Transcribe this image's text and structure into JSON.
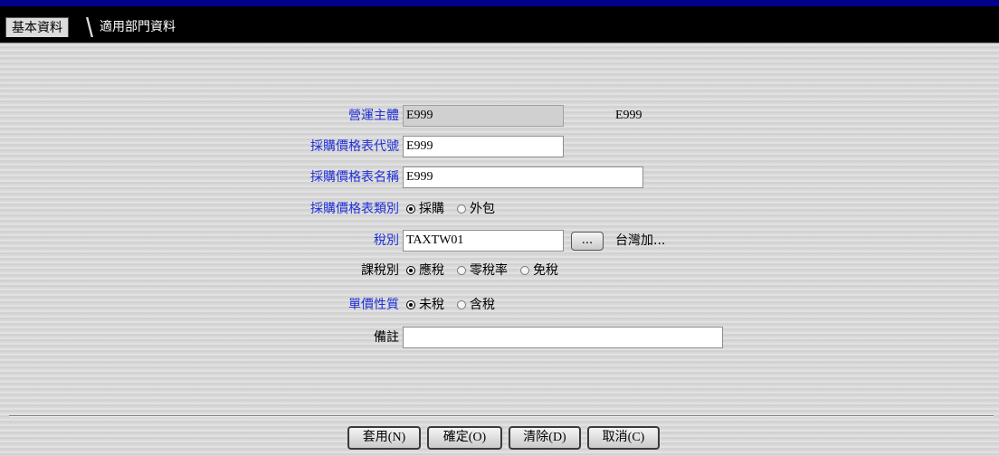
{
  "tabs": [
    {
      "label": "基本資料",
      "active": true
    },
    {
      "label": "適用部門資料",
      "active": false
    }
  ],
  "form": {
    "entity": {
      "label": "營運主體",
      "value": "E999",
      "display": "E999"
    },
    "code": {
      "label": "採購價格表代號",
      "value": "E999"
    },
    "name": {
      "label": "採購價格表名稱",
      "value": "E999"
    },
    "category": {
      "label": "採購價格表類別",
      "options": [
        "採購",
        "外包"
      ],
      "selected": "採購"
    },
    "tax": {
      "label": "稅別",
      "value": "TAXTW01",
      "lookup_label": "...",
      "description": "台灣加..."
    },
    "tax_type": {
      "label": "課稅別",
      "options": [
        "應稅",
        "零稅率",
        "免稅"
      ],
      "selected": "應稅"
    },
    "price_nature": {
      "label": "單價性質",
      "options": [
        "未稅",
        "含稅"
      ],
      "selected": "未稅"
    },
    "remark": {
      "label": "備註",
      "value": ""
    }
  },
  "buttons": {
    "apply": "套用(N)",
    "confirm": "確定(O)",
    "clear": "清除(D)",
    "cancel": "取消(C)"
  },
  "colors": {
    "title_bar": "#00008a",
    "label_blue": "#1e2fd6",
    "tab_strip": "#000000"
  }
}
